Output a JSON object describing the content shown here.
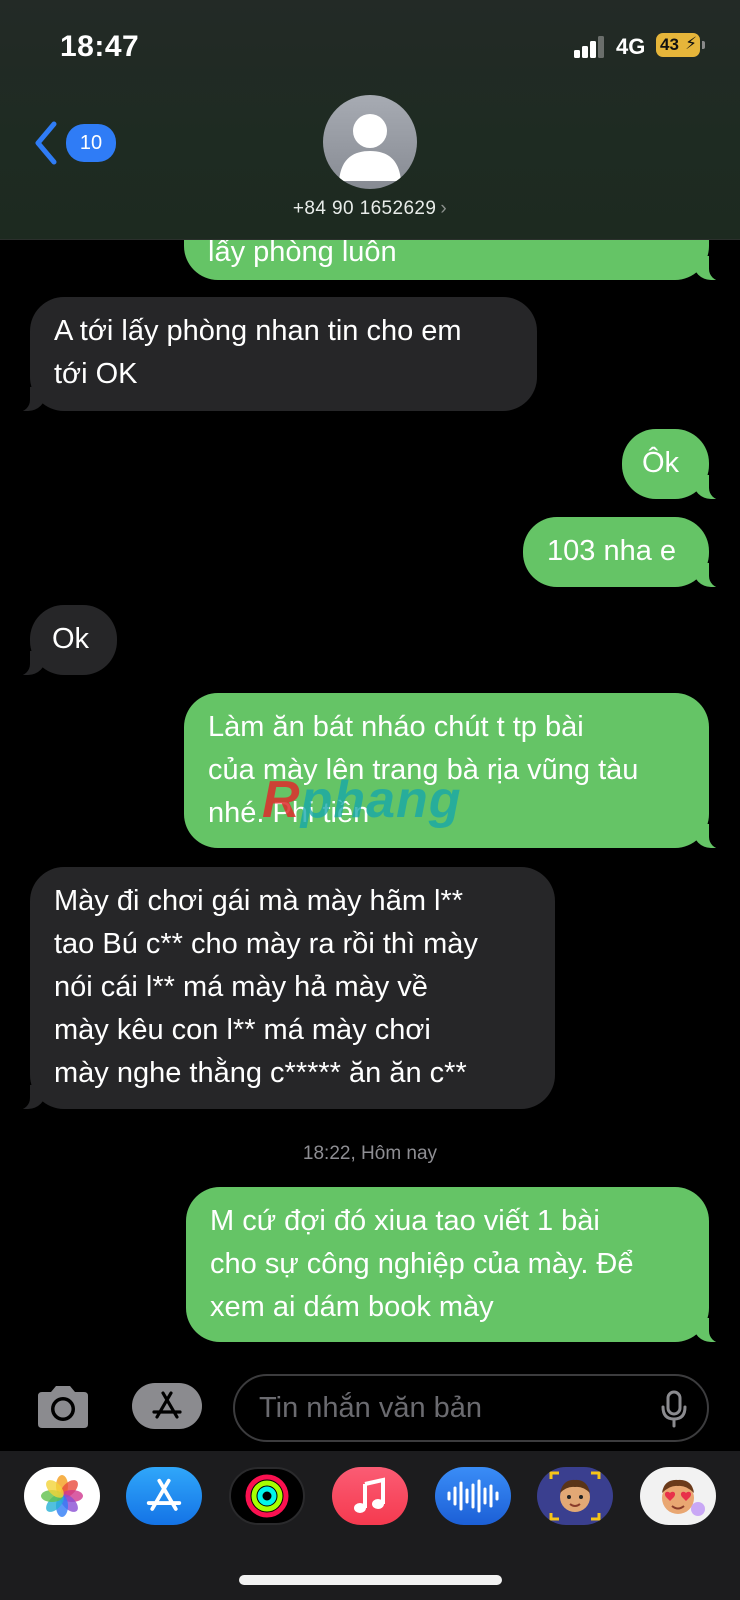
{
  "status_bar": {
    "time": "18:47",
    "network": "4G",
    "battery": "43"
  },
  "header": {
    "back_count": "10",
    "contact_number": "+84 90 1652629",
    "chevron": "›"
  },
  "messages": [
    {
      "type": "sent",
      "text": "lấy phòng luôn",
      "partial": true
    },
    {
      "type": "received",
      "text": "A tới lấy phòng nhan tin cho em\ntới OK"
    },
    {
      "type": "sent",
      "text": "Ôk"
    },
    {
      "type": "sent",
      "text": "103 nha e"
    },
    {
      "type": "received",
      "text": "Ok"
    },
    {
      "type": "sent",
      "text": "Làm ăn bát nháo chút t tp bài\ncủa mày lên trang bà rịa vũng tàu\nnhé. Phi tiền"
    },
    {
      "type": "received",
      "text": "Mày đi chơi gái mà mày hãm l**\ntao Bú c** cho mày ra rồi thì mày\nnói cái l** má mày hả mày về\nmày kêu con l** má mày chơi\nmày nghe thằng c***** ăn ăn c**"
    },
    {
      "type": "sent",
      "text": "M cứ đợi đó xiua tao viết 1 bài\ncho sự công nghiệp của mày. Để\nxem ai dám book mày"
    }
  ],
  "timestamp": "18:22, Hôm nay",
  "watermark": {
    "first": "R",
    "rest": "phang"
  },
  "input": {
    "placeholder": "Tin nhắn văn bản"
  },
  "app_drawer": {
    "apps": [
      {
        "name": "photos-app",
        "icon": "flower-icon"
      },
      {
        "name": "app-store-app",
        "icon": "app-store-icon"
      },
      {
        "name": "activity-app",
        "icon": "activity-rings-icon"
      },
      {
        "name": "music-app",
        "icon": "music-note-icon"
      },
      {
        "name": "audio-message-app",
        "icon": "waveform-icon"
      },
      {
        "name": "memoji-app",
        "icon": "memoji-icon"
      },
      {
        "name": "memoji-stickers-app",
        "icon": "sticker-icon"
      }
    ]
  },
  "colors": {
    "sent_bubble": "#65c466",
    "received_bubble": "#262628",
    "accent_blue": "#2f7cf6",
    "battery": "#e6b53a"
  }
}
